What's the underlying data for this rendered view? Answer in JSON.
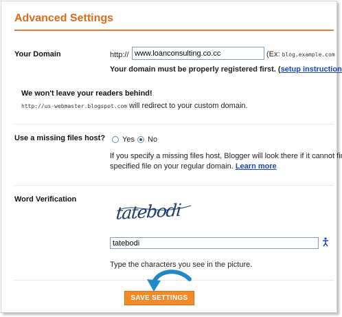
{
  "header": {
    "title": "Advanced Settings"
  },
  "domain": {
    "label": "Your Domain",
    "prefix": "http://",
    "value": "www.loanconsulting.co.cc",
    "example_lead": "(Ex:",
    "example_mono": "blog.example.com",
    "note_text": "Your domain must be properly registered first. (",
    "note_link": "setup instructions",
    "note_close": ")"
  },
  "redirect": {
    "heading": "We won't leave your readers behind!",
    "url_mono": "http://us-webmaster.blogspot.com",
    "text": " will redirect to your custom domain."
  },
  "missing_host": {
    "label": "Use a missing files host?",
    "options": [
      "Yes",
      "No"
    ],
    "selected": "No",
    "desc_line1": "If you specify a missing files host, Blogger will look there if it cannot find a",
    "desc_line2": "specified file on your regular domain.",
    "learn_more": "Learn more"
  },
  "verification": {
    "label": "Word Verification",
    "captcha_word": "tatebodi",
    "value": "tatebodi",
    "hint": "Type the characters you see in the picture."
  },
  "save_button": {
    "label": "SAVE SETTINGS"
  },
  "colors": {
    "accent": "#e06a1a",
    "button": "#f08a2a",
    "link": "#1a44b8",
    "arrow": "#1e88c8"
  }
}
